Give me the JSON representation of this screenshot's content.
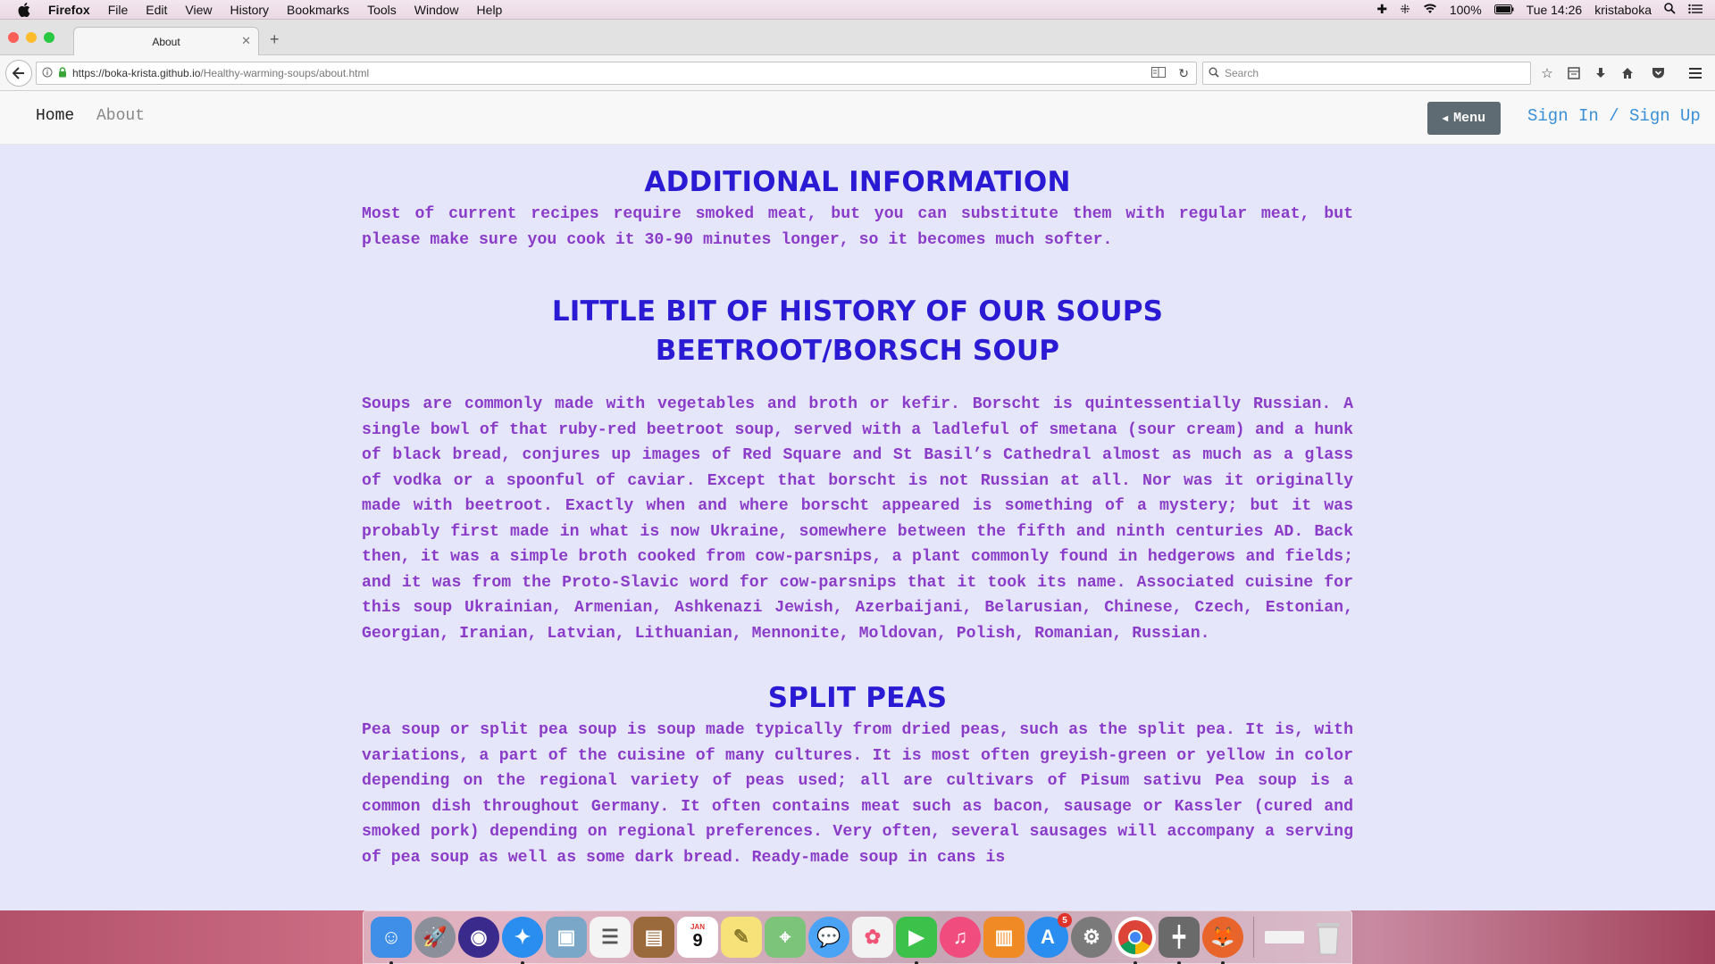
{
  "menubar": {
    "app": "Firefox",
    "items": [
      "File",
      "Edit",
      "View",
      "History",
      "Bookmarks",
      "Tools",
      "Window",
      "Help"
    ],
    "battery": "100%",
    "clock": "Tue 14:26",
    "user": "kristaboka"
  },
  "browser": {
    "tab_title": "About",
    "url_host": "https://boka-krista.github.io",
    "url_path": "/Healthy-warming-soups/about.html",
    "search_placeholder": "Search"
  },
  "site_nav": {
    "home": "Home",
    "about": "About",
    "menu_button": "Menu",
    "auth": "Sign In / Sign Up"
  },
  "sections": {
    "additional": {
      "title": "ADDITIONAL INFORMATION",
      "text": "Most of current recipes require smoked meat, but you can substitute them with regular meat, but please make sure you cook it 30-90 minutes longer, so it becomes much softer."
    },
    "history": {
      "title": "LITTLE BIT OF HISTORY OF OUR SOUPS",
      "subtitle": "BEETROOT/BORSCH SOUP",
      "text": "Soups are commonly made with vegetables and broth or kefir. Borscht is quintessentially Russian. A single bowl of that ruby-red beetroot soup, served with a ladleful of smetana (sour cream) and a hunk of black bread, conjures up images of Red Square and St Basil’s Cathedral almost as much as a glass of vodka or a spoonful of caviar. Except that borscht is not Russian at all. Nor was it originally made with beetroot. Exactly when and where borscht appeared is something of a mystery; but it was probably first made in what is now Ukraine, somewhere between the fifth and ninth centuries AD. Back then, it was a simple broth cooked from cow-parsnips, a plant commonly found in hedgerows and fields; and it was from the Proto-Slavic word for cow-parsnips that it took its name. Associated cuisine for this soup Ukrainian, Armenian, Ashkenazi Jewish, Azerbaijani, Belarusian, Chinese, Czech, Estonian, Georgian, Iranian, Latvian, Lithuanian, Mennonite, Moldovan, Polish, Romanian, Russian."
    },
    "split_peas": {
      "title": "SPLIT PEAS",
      "text": "Pea soup or split pea soup is soup made typically from dried peas, such as the split pea. It is, with variations, a part of the cuisine of many cultures. It is most often greyish-green or yellow in color depending on the regional variety of peas used; all are cultivars of Pisum sativu Pea soup is a common dish throughout Germany. It often contains meat such as bacon, sausage or Kassler (cured and smoked pork) depending on regional preferences. Very often, several sausages will accompany a serving of pea soup as well as some dark bread. Ready-made soup in cans is"
    }
  },
  "dock": {
    "calendar_day": "9",
    "calendar_month": "JAN",
    "appstore_badge": "5",
    "colors": {
      "finder": "#3f8fe8",
      "launchpad": "#8a8f99",
      "siri": "#3a2a8c",
      "safari": "#2a8ef0",
      "preview": "#7aa7c8",
      "reminders": "#f4f4f4",
      "notes_brown": "#9b6a3c",
      "calendar": "#ffffff",
      "notes": "#f7e27a",
      "maps": "#7cc47a",
      "messages": "#4aa3f5",
      "photos": "#f2f2f2",
      "facetime": "#3cc14a",
      "itunes": "#f04d7e",
      "ibooks": "#f08a24",
      "appstore": "#2a8ef0",
      "prefs": "#7a7a7a",
      "chrome": "#ffffff",
      "utility": "#6a6a6a",
      "firefox": "#e8642a",
      "trash": "#dcdcdc"
    }
  }
}
